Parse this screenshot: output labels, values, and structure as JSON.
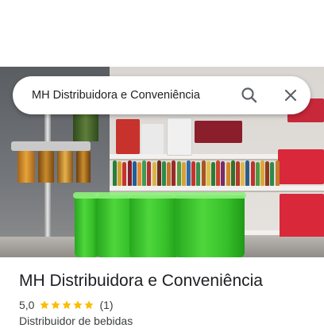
{
  "search": {
    "query": "MH Distribuidora e Conveniência",
    "icons": {
      "search": "search-icon",
      "close": "close-icon"
    }
  },
  "place": {
    "name": "MH Distribuidora e Conveniência",
    "rating": "5,0",
    "stars": 5,
    "review_count": "(1)",
    "category": "Distribuidor de bebidas"
  },
  "colors": {
    "star": "#fbbc04",
    "text_primary": "#202124",
    "text_secondary": "#3c4043",
    "icon": "#5f6368"
  }
}
